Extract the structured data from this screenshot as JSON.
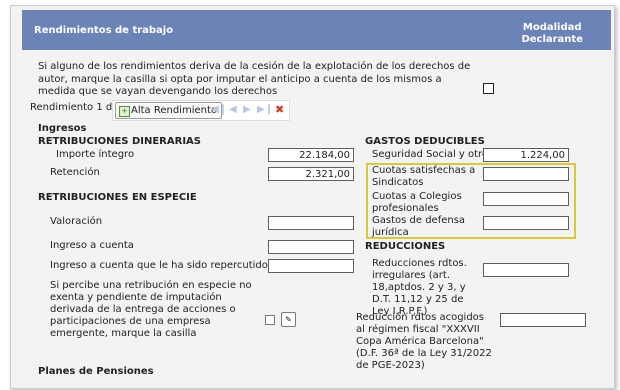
{
  "header": {
    "title": "Rendimientos de trabajo",
    "modalidad_line1": "Modalidad",
    "modalidad_line2": "Declarante"
  },
  "intro": "Si alguno de los rendimientos deriva de la cesión de la explotación de los derechos de autor, marque la casilla si opta por imputar el anticipo a cuenta de los mismos a medida que se vayan devengando los derechos",
  "record": {
    "label": "Rendimiento 1 de 1",
    "alta_button": "Alta Rendimiento"
  },
  "ingresos": {
    "title": "Ingresos",
    "dinerarias_title": "RETRIBUCIONES DINERARIAS",
    "importe_label": "Importe íntegro",
    "importe_value": "22.184,00",
    "retencion_label": "Retención",
    "retencion_value": "2.321,00",
    "especie_title": "RETRIBUCIONES EN ESPECIE",
    "valoracion_label": "Valoración",
    "valoracion_value": "",
    "ingreso_cuenta_label": "Ingreso a cuenta",
    "ingreso_cuenta_value": "",
    "ingreso_repercutido_label": "Ingreso a cuenta que le ha sido repercutido",
    "ingreso_repercutido_value": "",
    "especie_text": "Si percibe una retribución en especie no exenta y pendiente de imputación derivada de la entrega de acciones o participaciones de una empresa emergente, marque la casilla"
  },
  "gastos": {
    "title": "GASTOS DEDUCIBLES",
    "seguridad_label": "Seguridad Social y otros",
    "seguridad_value": "1.224,00",
    "cuotas_sindicatos_label": "Cuotas satisfechas a Sindicatos",
    "cuotas_sindicatos_value": "",
    "cuotas_colegios_label": "Cuotas a Colegios profesionales",
    "cuotas_colegios_value": "",
    "defensa_label": "Gastos de defensa jurídica",
    "defensa_value": ""
  },
  "reducciones": {
    "title": "REDUCCIONES",
    "irregulares_label": "Reducciones rdtos. irregulares (art. 18,aptdos. 2 y 3, y D.T. 11,12 y 25 de Ley I.R.P.F.)",
    "irregulares_value": "",
    "copa_label": "Reducción rdtos acogidos al régimen fiscal \"XXXVII Copa América Barcelona\" (D.F. 36ª de la Ley 31/2022 de PGE-2023)",
    "copa_value": ""
  },
  "planes": {
    "title": "Planes de Pensiones"
  }
}
